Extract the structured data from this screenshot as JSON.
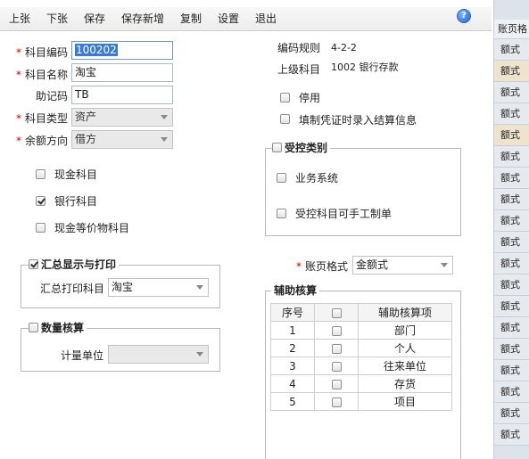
{
  "toolbar": {
    "prev": "上张",
    "next": "下张",
    "save": "保存",
    "save_new": "保存新增",
    "copy": "复制",
    "settings": "设置",
    "exit": "退出",
    "help_icon": "help-icon"
  },
  "form": {
    "code_label": "科目编码",
    "code_value": "100202",
    "name_label": "科目名称",
    "name_value": "淘宝",
    "mnemonic_label": "助记码",
    "mnemonic_value": "TB",
    "type_label": "科目类型",
    "type_value": "资产",
    "balance_label": "余额方向",
    "balance_value": "借方",
    "cash_label": "现金科目",
    "bank_label": "银行科目",
    "cash_equiv_label": "现金等价物科目"
  },
  "right": {
    "code_rule_label": "编码规则",
    "code_rule_value": "4-2-2",
    "parent_label": "上级科目",
    "parent_value": "1002 银行存款",
    "disabled_label": "停用",
    "settlement_label": "填制凭证时录入结算信息",
    "ledger_label": "账页格式",
    "ledger_value": "金额式"
  },
  "controlled": {
    "title": "受控类别",
    "business_label": "业务系统",
    "manual_label": "受控科目可手工制单"
  },
  "summary": {
    "title": "汇总显示与打印",
    "print_label": "汇总打印科目",
    "print_value": "淘宝"
  },
  "quantity": {
    "title": "数量核算",
    "unit_label": "计量单位",
    "unit_value": ""
  },
  "aux": {
    "title": "辅助核算",
    "col_no": "序号",
    "col_item": "辅助核算项",
    "rows": [
      {
        "no": "1",
        "item": "部门"
      },
      {
        "no": "2",
        "item": "个人"
      },
      {
        "no": "3",
        "item": "往来单位"
      },
      {
        "no": "4",
        "item": "存货"
      },
      {
        "no": "5",
        "item": "项目"
      }
    ]
  },
  "background": {
    "header": "账页格",
    "cells": [
      "额式",
      "额式",
      "额式",
      "额式",
      "额式",
      "额式",
      "额式",
      "额式",
      "额式",
      "额式",
      "额式",
      "额式",
      "额式",
      "额式",
      "额式",
      "额式",
      "额式",
      "额式",
      "额式"
    ]
  },
  "colors": {
    "required": "#cc0000",
    "selection": "#3b79d6"
  }
}
